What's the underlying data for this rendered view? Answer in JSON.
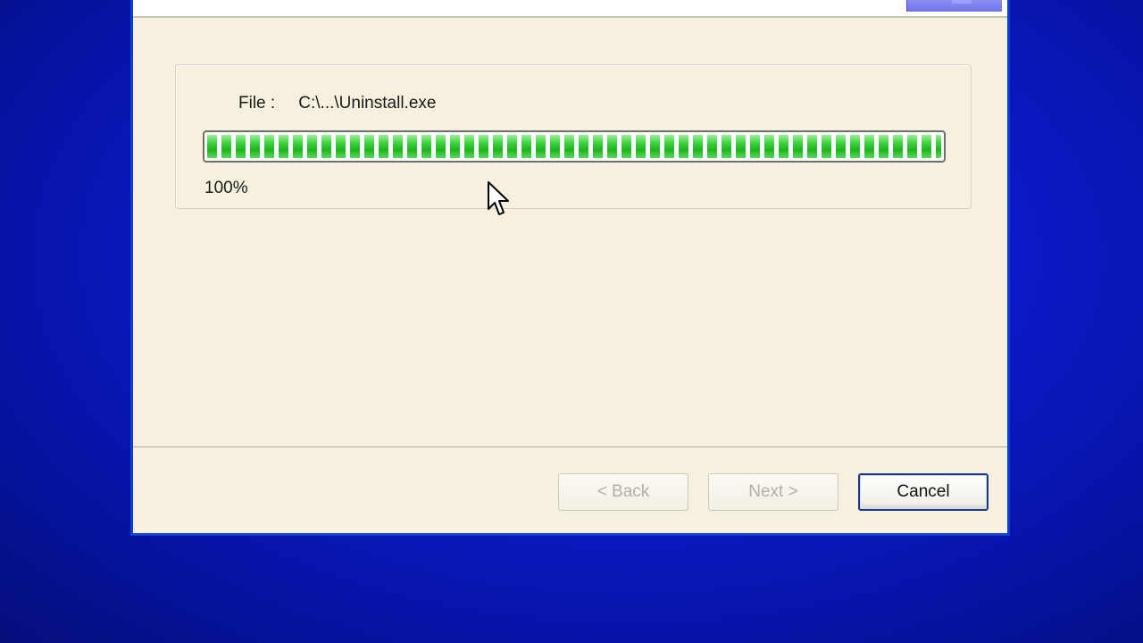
{
  "installer": {
    "file_label": "File :",
    "file_path": "C:\\...\\Uninstall.exe",
    "progress_percent_text": "100%",
    "progress_fraction": 1.0
  },
  "buttons": {
    "back_label": "< Back",
    "next_label": "Next >",
    "cancel_label": "Cancel"
  },
  "colors": {
    "desktop_background": "#0b1bd0",
    "dialog_background": "#f6f1df",
    "progress_green": "#3fd33f"
  },
  "icons": {
    "cursor": "mouse-pointer-icon"
  }
}
